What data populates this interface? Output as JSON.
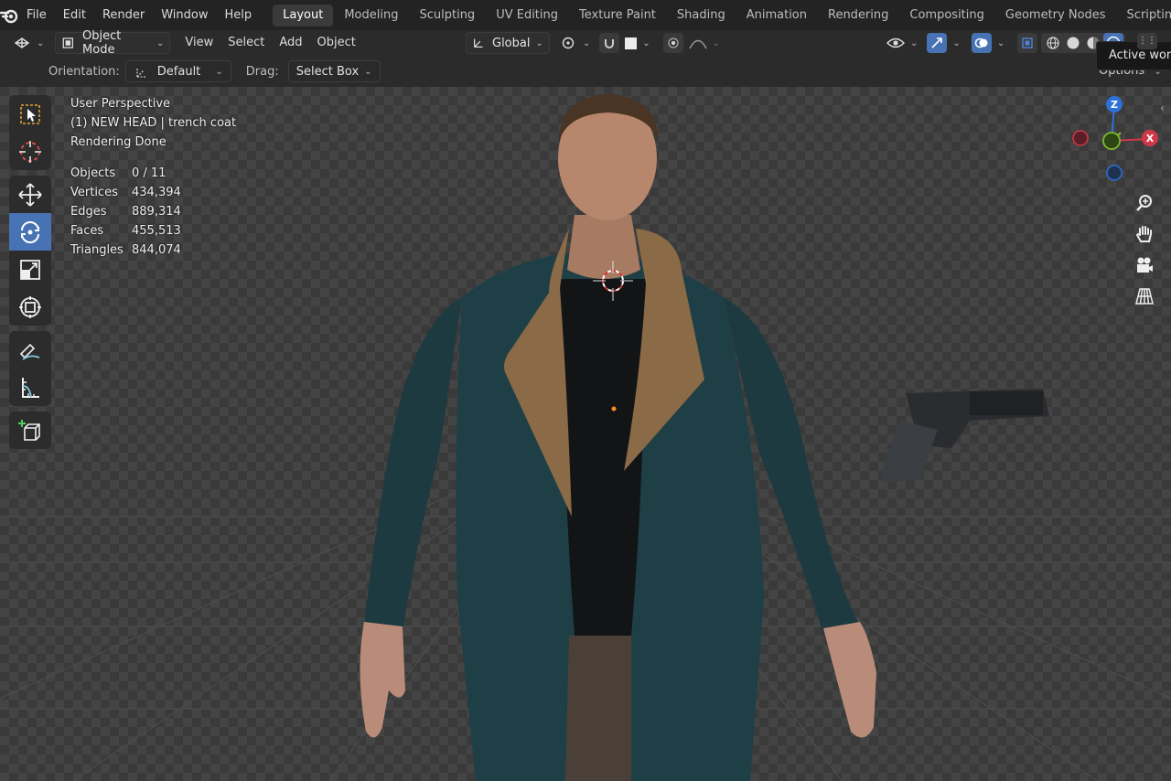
{
  "menu": {
    "file": "File",
    "edit": "Edit",
    "render": "Render",
    "window": "Window",
    "help": "Help"
  },
  "workspaces": [
    "Layout",
    "Modeling",
    "Sculpting",
    "UV Editing",
    "Texture Paint",
    "Shading",
    "Animation",
    "Rendering",
    "Compositing",
    "Geometry Nodes",
    "Scripting"
  ],
  "header": {
    "mode": "Object Mode",
    "view": "View",
    "select": "Select",
    "add": "Add",
    "object": "Object",
    "transform_orientation": "Global"
  },
  "tool_settings": {
    "orientation_label": "Orientation:",
    "orientation_value": "Default",
    "drag_label": "Drag:",
    "drag_value": "Select Box",
    "options": "Options"
  },
  "tooltip": "Active work",
  "overlay": {
    "view_name": "User Perspective",
    "collection": "(1) NEW HEAD | trench coat",
    "status": "Rendering Done",
    "stats": [
      {
        "k": "Objects",
        "v": "0 / 11"
      },
      {
        "k": "Vertices",
        "v": "434,394"
      },
      {
        "k": "Edges",
        "v": "889,314"
      },
      {
        "k": "Faces",
        "v": "455,513"
      },
      {
        "k": "Triangles",
        "v": "844,074"
      }
    ]
  },
  "gizmo": {
    "z": "Z",
    "x": "X",
    "colors": {
      "x": "#d0384a",
      "y": "#7db92a",
      "z": "#2d70d8"
    }
  }
}
